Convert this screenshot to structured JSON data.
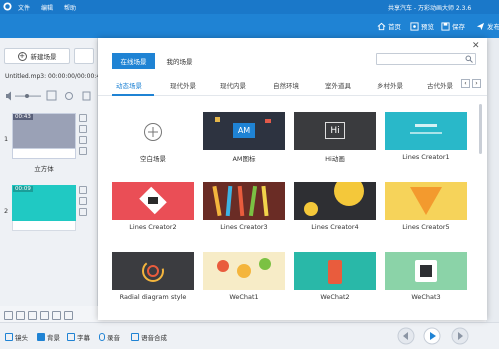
{
  "titlebar": {
    "menu": [
      "文件",
      "编辑",
      "帮助"
    ],
    "title": "共享汽车 - 万彩动画大师 2.3.6"
  },
  "toolbar": {
    "home": "首页",
    "preview": "预览",
    "save": "保存",
    "publish": "发布"
  },
  "left": {
    "new_scene": "新建场景",
    "file_info": "Untitled.mp3: 00:00:00/00:00:48",
    "scenes": [
      {
        "num": "1",
        "time": "00:43",
        "label": "立方体"
      },
      {
        "num": "2",
        "time": "00:09",
        "label": ""
      }
    ]
  },
  "modal": {
    "tabs": [
      "在线场景",
      "我的场景"
    ],
    "search_placeholder": "",
    "categories": [
      "动态场景",
      "现代外景",
      "现代内景",
      "自然环境",
      "室外道具",
      "乡村外景",
      "古代外景"
    ],
    "cards": [
      {
        "label": "空白场景"
      },
      {
        "label": "AM图标",
        "icon_text": "AM"
      },
      {
        "label": "Hi动画",
        "icon_text": "Hi"
      },
      {
        "label": "Lines Creator1"
      },
      {
        "label": "Lines Creator2"
      },
      {
        "label": "Lines Creator3"
      },
      {
        "label": "Lines Creator4"
      },
      {
        "label": "Lines Creator5"
      },
      {
        "label": "Radial diagram style"
      },
      {
        "label": "WeChat1"
      },
      {
        "label": "WeChat2"
      },
      {
        "label": "WeChat3"
      }
    ]
  },
  "bottom": {
    "items": [
      "镜头",
      "背景",
      "字幕",
      "录音",
      "语音合成"
    ]
  },
  "colors": {
    "titlebar": "#1a78c9",
    "toolbar": "#1f83d4",
    "accent": "#1f83d4"
  }
}
